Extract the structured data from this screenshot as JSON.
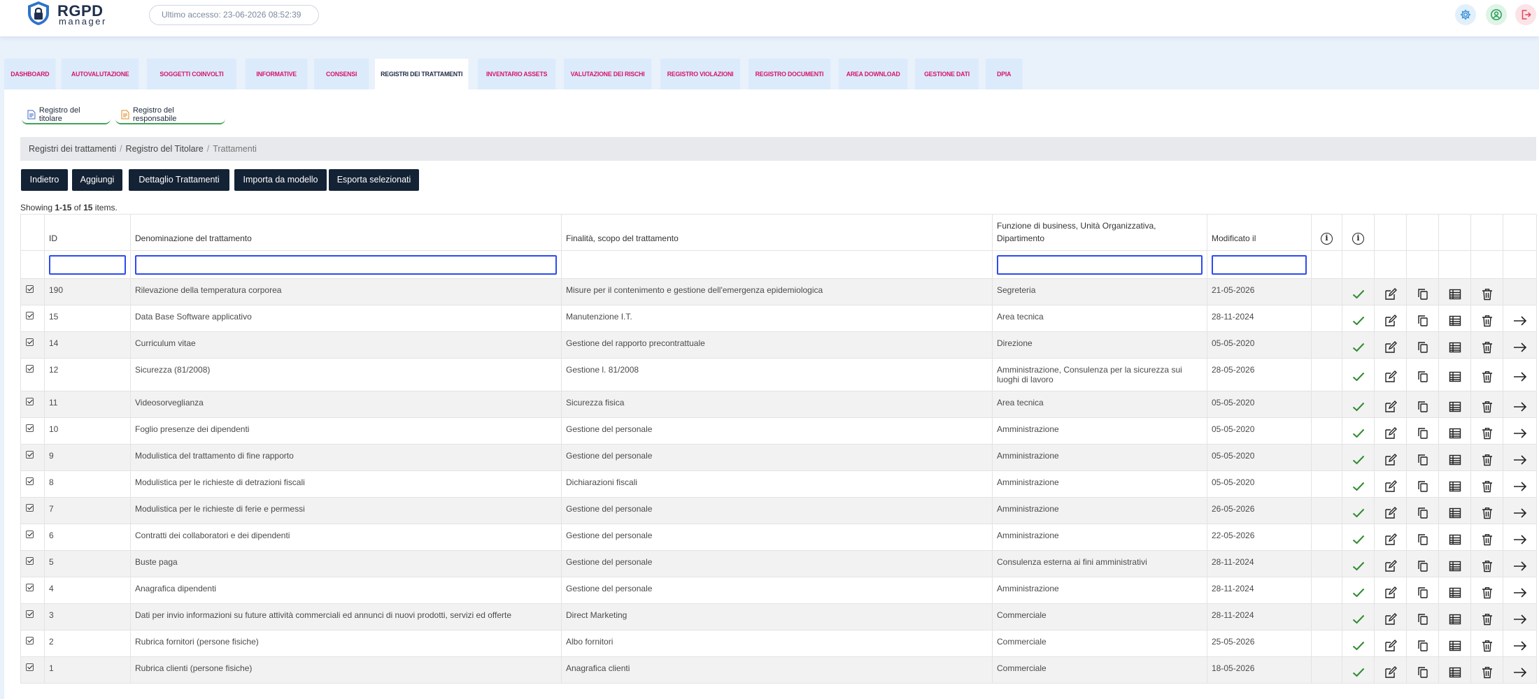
{
  "app": {
    "logo_title": "RGPD",
    "logo_subtitle": "manager",
    "last_access": "Ultimo accesso: 23-06-2026 08:52:39"
  },
  "topbar_icons": [
    "gear-icon",
    "user-circle-icon",
    "logout-icon"
  ],
  "tabs": [
    {
      "label": "DASHBOARD",
      "active": false
    },
    {
      "label": "AUTOVALUTAZIONE",
      "active": false
    },
    {
      "label": "SOGGETTI COINVOLTI",
      "active": false
    },
    {
      "label": "INFORMATIVE",
      "active": false
    },
    {
      "label": "CONSENSI",
      "active": false
    },
    {
      "label": "REGISTRI DEI TRATTAMENTI",
      "active": true
    },
    {
      "label": "INVENTARIO ASSETS",
      "active": false
    },
    {
      "label": "VALUTAZIONE DEI RISCHI",
      "active": false
    },
    {
      "label": "REGISTRO VIOLAZIONI",
      "active": false
    },
    {
      "label": "REGISTRO DOCUMENTI",
      "active": false
    },
    {
      "label": "AREA DOWNLOAD",
      "active": false
    },
    {
      "label": "GESTIONE DATI",
      "active": false
    },
    {
      "label": "DPIA",
      "active": false
    }
  ],
  "registers": {
    "titolare": "Registro del titolare",
    "responsabile": "Registro del responsabile"
  },
  "breadcrumb": {
    "item1": "Registri dei trattamenti",
    "item2": "Registro del Titolare",
    "current": "Trattamenti"
  },
  "actions": {
    "back": "Indietro",
    "add": "Aggiungi",
    "detail": "Dettaglio Trattamenti",
    "import": "Importa da modello",
    "export": "Esporta selezionati"
  },
  "summary": {
    "prefix": "Showing ",
    "range": "1-15",
    "of": " of ",
    "total": "15",
    "suffix": " items."
  },
  "columns": {
    "id": "ID",
    "name": "Denominazione del trattamento",
    "purpose": "Finalità, scopo del trattamento",
    "function": "Funzione di business, Unità Organizzativa, Dipartimento",
    "modified": "Modificato il"
  },
  "rows": [
    {
      "id": "190",
      "name": "Rilevazione della temperatura corporea",
      "purpose": "Misure per il contenimento e gestione dell'emergenza epidemiologica",
      "function": "Segreteria",
      "modified": "21-05-2026",
      "has_arrow": false
    },
    {
      "id": "15",
      "name": "Data Base Software applicativo",
      "purpose": "Manutenzione I.T.",
      "function": "Area tecnica",
      "modified": "28-11-2024",
      "has_arrow": true
    },
    {
      "id": "14",
      "name": "Curriculum vitae",
      "purpose": "Gestione del rapporto precontrattuale",
      "function": "Direzione",
      "modified": "05-05-2020",
      "has_arrow": true
    },
    {
      "id": "12",
      "name": "Sicurezza (81/2008)",
      "purpose": "Gestione l. 81/2008",
      "function": "Amministrazione, Consulenza per la sicurezza sui luoghi di lavoro",
      "modified": "28-05-2026",
      "has_arrow": true
    },
    {
      "id": "11",
      "name": "Videosorveglianza",
      "purpose": "Sicurezza fisica",
      "function": "Area tecnica",
      "modified": "05-05-2020",
      "has_arrow": true
    },
    {
      "id": "10",
      "name": "Foglio presenze dei dipendenti",
      "purpose": "Gestione del personale",
      "function": "Amministrazione",
      "modified": "05-05-2020",
      "has_arrow": true
    },
    {
      "id": "9",
      "name": "Modulistica del trattamento di fine rapporto",
      "purpose": "Gestione del personale",
      "function": "Amministrazione",
      "modified": "05-05-2020",
      "has_arrow": true
    },
    {
      "id": "8",
      "name": "Modulistica per le richieste di detrazioni fiscali",
      "purpose": "Dichiarazioni fiscali",
      "function": "Amministrazione",
      "modified": "05-05-2020",
      "has_arrow": true
    },
    {
      "id": "7",
      "name": "Modulistica per le richieste di ferie e permessi",
      "purpose": "Gestione del personale",
      "function": "Amministrazione",
      "modified": "26-05-2026",
      "has_arrow": true
    },
    {
      "id": "6",
      "name": "Contratti dei collaboratori e dei dipendenti",
      "purpose": "Gestione del personale",
      "function": "Amministrazione",
      "modified": "22-05-2026",
      "has_arrow": true
    },
    {
      "id": "5",
      "name": "Buste paga",
      "purpose": "Gestione del personale",
      "function": "Consulenza esterna ai fini amministrativi",
      "modified": "28-11-2024",
      "has_arrow": true
    },
    {
      "id": "4",
      "name": "Anagrafica dipendenti",
      "purpose": "Gestione del personale",
      "function": "Amministrazione",
      "modified": "28-11-2024",
      "has_arrow": true
    },
    {
      "id": "3",
      "name": "Dati per invio informazioni su future attività commerciali ed annunci di nuovi prodotti, servizi ed offerte",
      "purpose": "Direct Marketing",
      "function": "Commerciale",
      "modified": "28-11-2024",
      "has_arrow": true
    },
    {
      "id": "2",
      "name": "Rubrica fornitori (persone fisiche)",
      "purpose": "Albo fornitori",
      "function": "Commerciale",
      "modified": "25-05-2026",
      "has_arrow": true
    },
    {
      "id": "1",
      "name": "Rubrica clienti (persone fisiche)",
      "purpose": "Anagrafica clienti",
      "function": "Commerciale",
      "modified": "18-05-2026",
      "has_arrow": true
    }
  ],
  "row_action_icons": [
    "check-icon",
    "edit-icon",
    "copy-icon",
    "table-icon",
    "trash-icon",
    "arrow-right-icon"
  ],
  "colors": {
    "accent": "#d6156b",
    "dark_button": "#142235",
    "tab_bg": "#dcebfb",
    "check": "#2e8b2e"
  }
}
